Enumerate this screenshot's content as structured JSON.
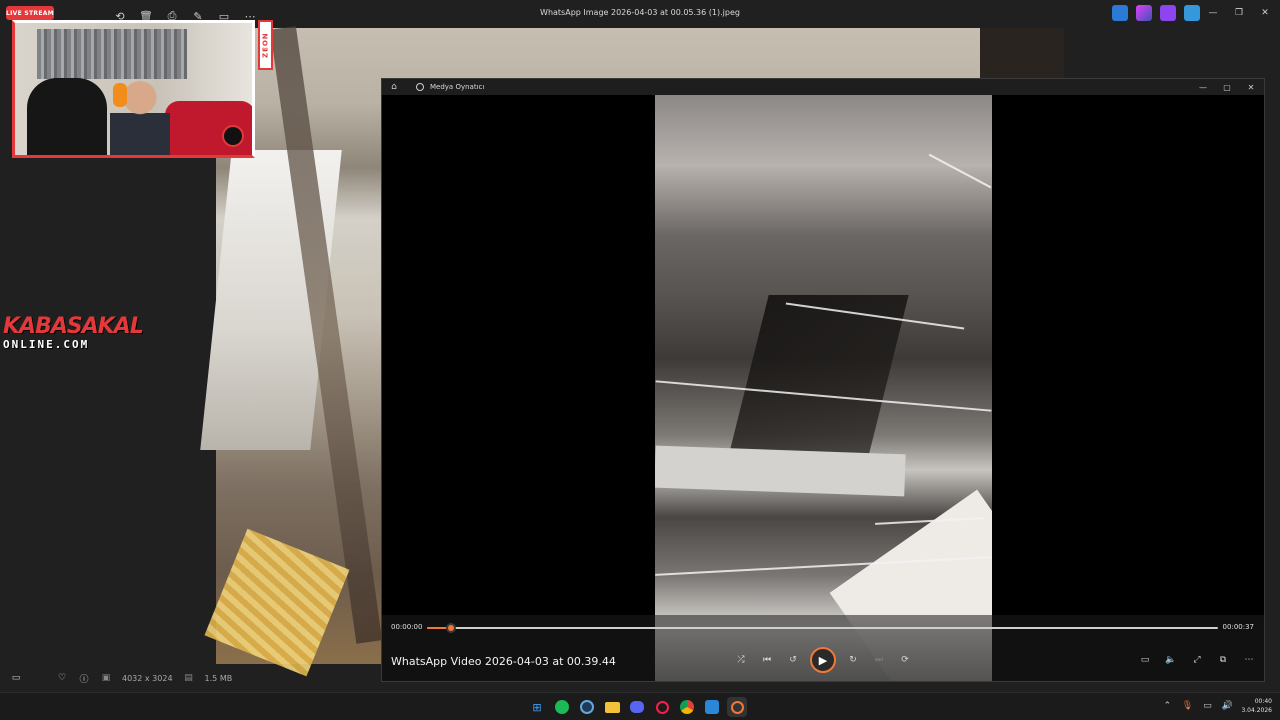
{
  "photos_app": {
    "title": "WhatsApp Image 2026-04-03 at 00.05.36 (1).jpeg",
    "toolbar_icons": [
      "rotate-icon",
      "delete-icon",
      "print-icon",
      "edit-icon",
      "slideshow-icon",
      "more-icon"
    ],
    "status": {
      "dimensions": "4032 x 3024",
      "size": "1.5 MB"
    }
  },
  "overlay": {
    "live_badge": "LIVE STREAM",
    "sponsor": "ZEON",
    "brand_top": "KABASAKAL",
    "brand_bottom": "ONLINE.COM"
  },
  "media_player": {
    "app_title": "Medya Oynatıcı",
    "video_title": "WhatsApp Video 2026-04-03 at 00.39.44",
    "time_current": "00:00:00",
    "time_total": "00:00:37",
    "progress_fraction": 0.03,
    "accent_color": "#f07838"
  },
  "taskbar": {
    "apps": [
      "windows-start",
      "spotify",
      "steam",
      "file-explorer",
      "discord",
      "opera-gx",
      "chrome",
      "snipping-tool",
      "media-player"
    ],
    "clock_time": "00:40",
    "clock_date": "3.04.2026"
  }
}
